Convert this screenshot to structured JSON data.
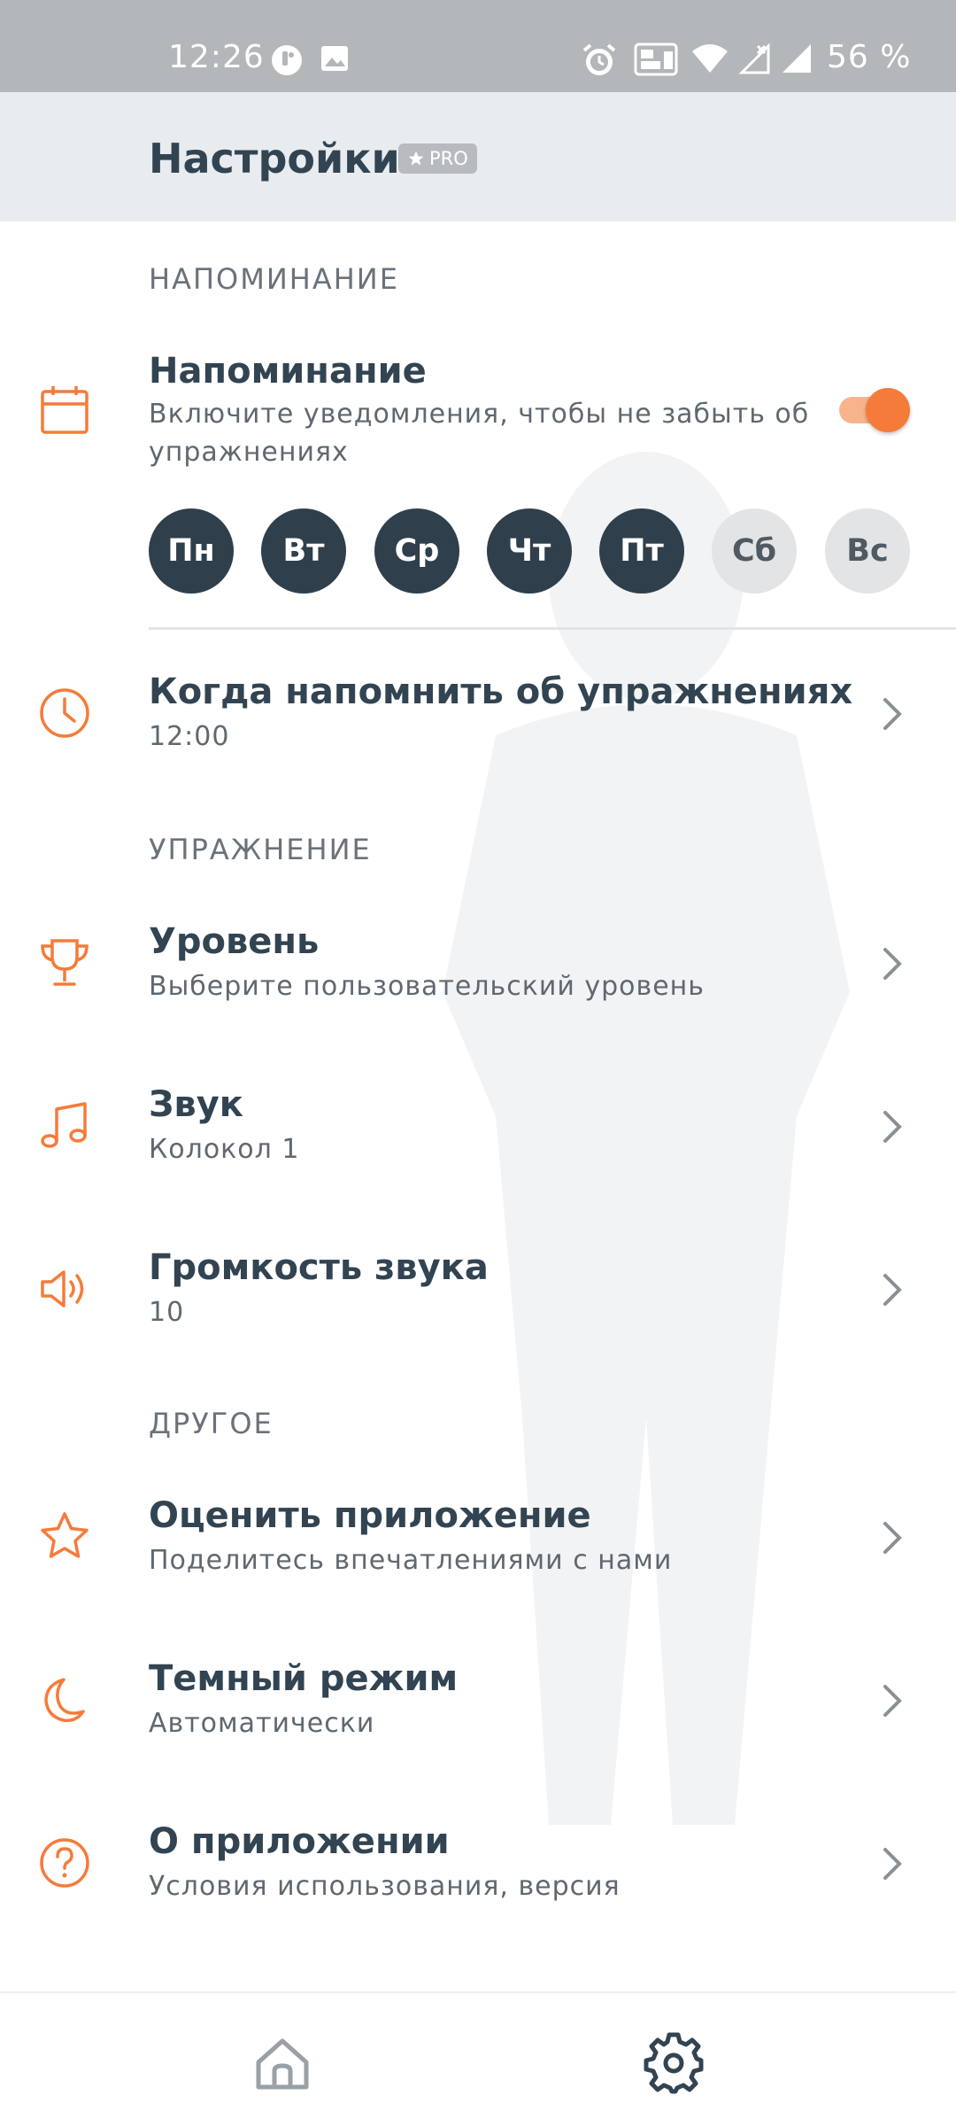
{
  "status_bar": {
    "time": "12:26",
    "battery": "56 %"
  },
  "header": {
    "title": "Настройки",
    "badge": "PRO"
  },
  "sections": {
    "reminder": "НАПОМИНАНИЕ",
    "exercise": "УПРАЖНЕНИЕ",
    "other": "ДРУГОЕ"
  },
  "reminder": {
    "title": "Напоминание",
    "subtitle": "Включите уведомления, чтобы не забыть об упражнениях",
    "enabled": true,
    "days": [
      {
        "label": "Пн",
        "active": true
      },
      {
        "label": "Вт",
        "active": true
      },
      {
        "label": "Ср",
        "active": true
      },
      {
        "label": "Чт",
        "active": true
      },
      {
        "label": "Пт",
        "active": true
      },
      {
        "label": "Сб",
        "active": false
      },
      {
        "label": "Вс",
        "active": false
      }
    ]
  },
  "reminder_time": {
    "title": "Когда напомнить об упражнениях",
    "value": "12:00"
  },
  "level": {
    "title": "Уровень",
    "subtitle": "Выберите пользовательский уровень"
  },
  "sound": {
    "title": "Звук",
    "subtitle": "Колокол 1"
  },
  "volume": {
    "title": "Громкость звука",
    "value": "10"
  },
  "rate": {
    "title": "Оценить приложение",
    "subtitle": "Поделитесь впечатлениями с нами"
  },
  "dark_mode": {
    "title": "Темный режим",
    "subtitle": "Автоматически"
  },
  "about": {
    "title": "О приложении",
    "subtitle": "Условия использования, версия"
  },
  "colors": {
    "accent": "#F57B3A",
    "text_dark": "#324452",
    "header_bg": "#E8ECEF"
  },
  "bottom_nav": [
    "home-icon",
    "settings-icon"
  ]
}
